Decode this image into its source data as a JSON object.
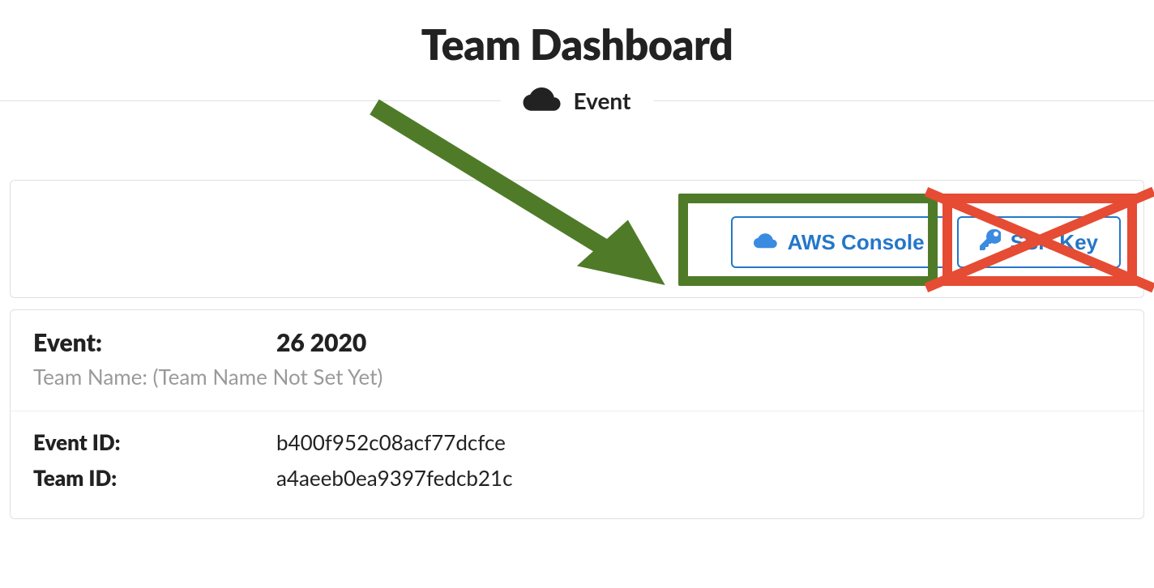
{
  "page": {
    "title": "Team Dashboard",
    "section_label": "Event"
  },
  "buttons": {
    "aws_console": "AWS Console",
    "ssh_key": "SSH Key"
  },
  "details": {
    "event_label": "Event:",
    "event_value": "26 2020",
    "team_name_label": "Team Name: (Team Name Not Set Yet)",
    "event_id_label": "Event ID:",
    "event_id_value": "b400f952c08acf77dcfce",
    "team_id_label": "Team ID:",
    "team_id_value": "a4aeeb0ea9397fedcb21c"
  },
  "annotations": {
    "green_highlight_target": "aws-console-button",
    "red_crossout_target": "ssh-key-button",
    "arrow_color": "#4f7b29",
    "red_color": "#e64b33"
  }
}
